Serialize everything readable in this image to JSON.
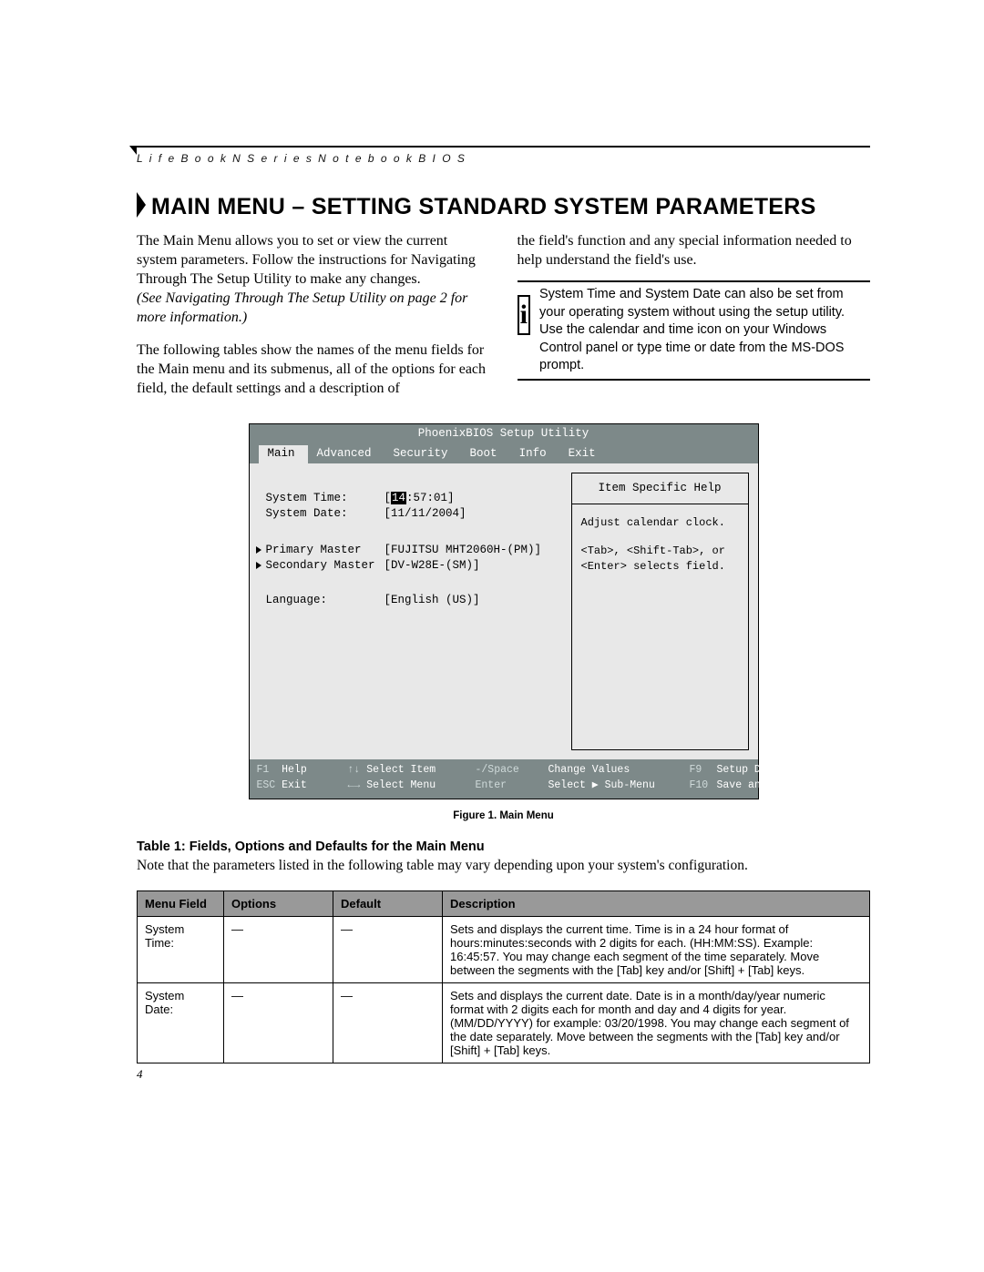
{
  "header": "L i f e B o o k  N  S e r i e s  N o t e b o o k  B I O S",
  "title": "MAIN MENU – SETTING STANDARD SYSTEM PARAMETERS",
  "intro": {
    "p1": "The Main Menu allows you to set or view the current system parameters. Follow the instructions for Navigating Through The Setup Utility to make any changes.",
    "p1i": "(See Navigating Through The Setup Utility on page 2 for more information.)",
    "p2": "The following tables show the names of the menu fields for the Main menu and its submenus, all of the options for each field, the default settings and a description of",
    "p3": "the field's function and any special information needed to help understand the field's use.",
    "info": "System Time and System Date can also be set from your operating system without using the setup utility. Use the calendar and time icon on your Windows Control panel or type time or date from the MS-DOS prompt."
  },
  "bios": {
    "title": "PhoenixBIOS Setup Utility",
    "tabs": [
      "Main",
      "Advanced",
      "Security",
      "Boot",
      "Info",
      "Exit"
    ],
    "rows": {
      "systime_label": "System Time:",
      "systime_hour": "14",
      "systime_rest": ":57:01]",
      "sysdate_label": "System Date:",
      "sysdate_val": "[11/11/2004]",
      "pm_label": "Primary Master",
      "pm_val": "[FUJITSU MHT2060H-(PM)]",
      "sm_label": "Secondary Master",
      "sm_val": "[DV-W28E-(SM)]",
      "lang_label": "Language:",
      "lang_val": "[English (US)]"
    },
    "help": {
      "head": "Item Specific Help",
      "l1": "Adjust calendar clock.",
      "l2": "<Tab>, <Shift-Tab>, or",
      "l3": "<Enter> selects field."
    },
    "footer": {
      "a1": "F1",
      "a2": "Help",
      "a3": "↑↓",
      "a4": "Select Item",
      "a5": "-/Space",
      "a6": "Change Values",
      "a7": "F9",
      "a8": "Setup Defaults",
      "b1": "ESC",
      "b2": "Exit",
      "b3": "←→",
      "b4": "Select Menu",
      "b5": "Enter",
      "b6": "Select ▶ Sub-Menu",
      "b7": "F10",
      "b8": "Save and Exit"
    }
  },
  "figcaption": "Figure 1.  Main Menu",
  "table": {
    "title": "Table 1: Fields, Options and Defaults for the Main Menu",
    "note": "Note that the parameters listed in the following table may vary depending upon your system's configuration.",
    "headers": [
      "Menu Field",
      "Options",
      "Default",
      "Description"
    ],
    "rows": [
      {
        "f": "System Time:",
        "o": "—",
        "d": "—",
        "desc": "Sets and displays the current time. Time is in a 24 hour format of hours:minutes:seconds with 2 digits for each. (HH:MM:SS). Example: 16:45:57. You may change each segment of the time separately. Move between the segments with the [Tab] key and/or [Shift] + [Tab] keys."
      },
      {
        "f": "System Date:",
        "o": "—",
        "d": "—",
        "desc": "Sets and displays the current date. Date is in a month/day/year numeric format with 2 digits each for month and day and 4 digits for year. (MM/DD/YYYY) for example: 03/20/1998. You may change each segment of the date separately. Move between the segments with the [Tab] key and/or [Shift] + [Tab] keys."
      }
    ]
  },
  "page_number": "4"
}
